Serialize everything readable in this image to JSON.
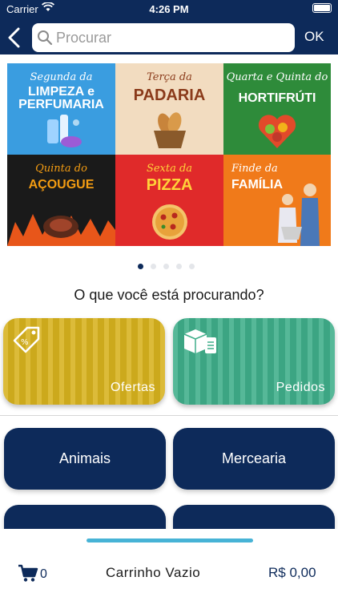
{
  "status_bar": {
    "carrier": "Carrier",
    "time": "4:26 PM"
  },
  "header": {
    "search_placeholder": "Procurar",
    "ok_label": "OK",
    "back_icon": "chevron-left-icon"
  },
  "banner": {
    "tiles": [
      {
        "script": "Segunda da",
        "title": "LIMPEZA e PERFUMARIA"
      },
      {
        "script": "Terça da",
        "title": "PADARIA"
      },
      {
        "script": "Quarta e Quinta do",
        "title": "HORTIFRÚTI"
      },
      {
        "script": "Quinta do",
        "title": "AÇOUGUE"
      },
      {
        "script": "Sexta da",
        "title": "PIZZA"
      },
      {
        "script": "Finde da",
        "title": "FAMÍLIA"
      }
    ],
    "page_count": 5,
    "active_page": 1
  },
  "question": "O que você está procurando?",
  "feature_cards": [
    {
      "label": "Ofertas",
      "icon": "price-tag-icon",
      "color": "#d7b21e"
    },
    {
      "label": "Pedidos",
      "icon": "order-boxes-icon",
      "color": "#3fae8a"
    }
  ],
  "categories": [
    {
      "label": "Animais"
    },
    {
      "label": "Mercearia"
    },
    {
      "label": ""
    },
    {
      "label": ""
    }
  ],
  "cart": {
    "count": "0",
    "title": "Carrinho Vazio",
    "total": "R$ 0,00"
  },
  "colors": {
    "primary": "#0d2a5a",
    "handle": "#47b3d6"
  }
}
